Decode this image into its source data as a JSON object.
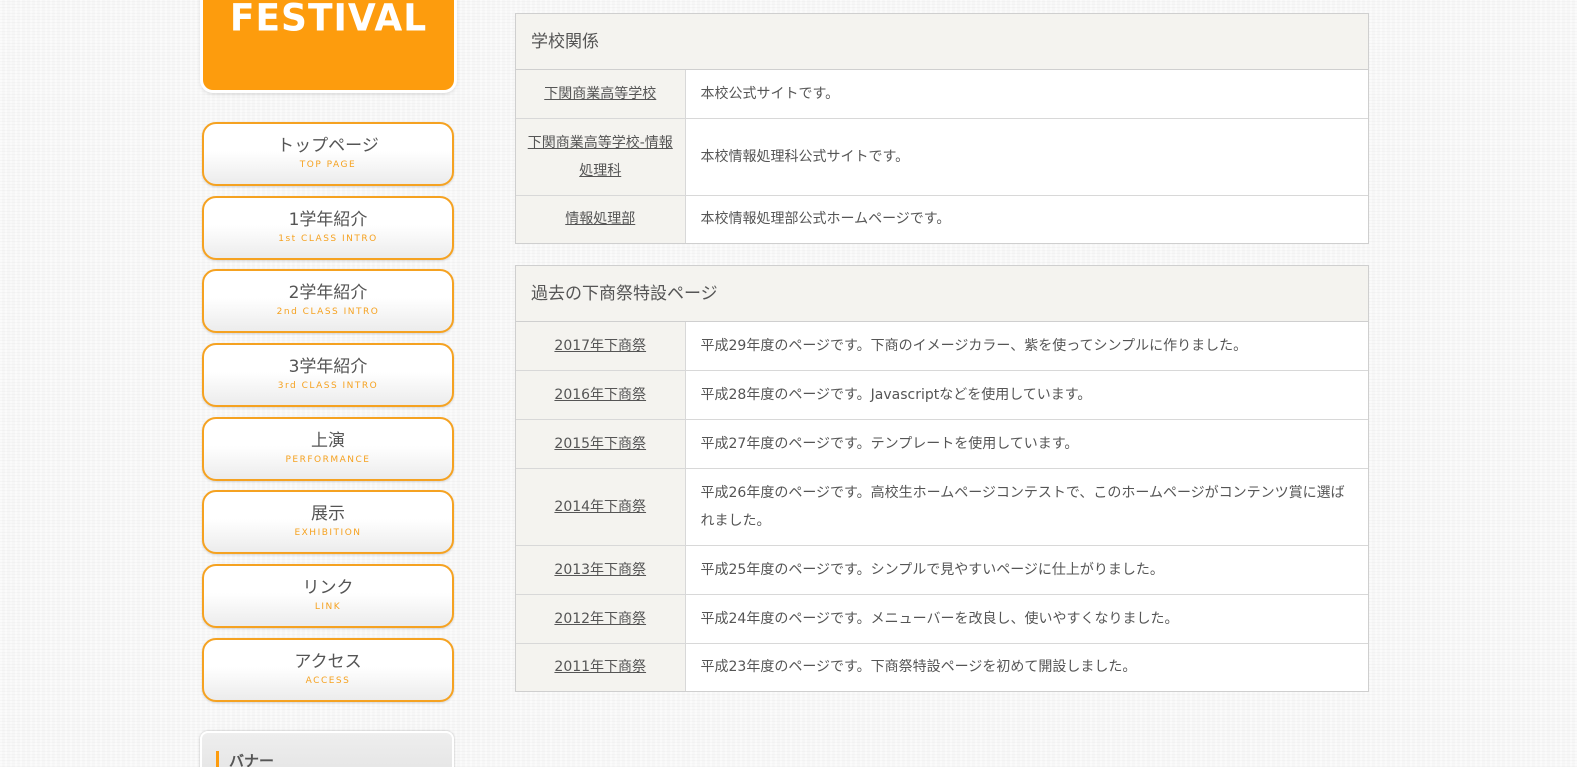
{
  "logo": {
    "text": "FESTIVAL"
  },
  "nav": [
    {
      "label": "トップページ",
      "sub": "TOP PAGE"
    },
    {
      "label": "1学年紹介",
      "sub": "1st CLASS INTRO"
    },
    {
      "label": "2学年紹介",
      "sub": "2nd CLASS INTRO"
    },
    {
      "label": "3学年紹介",
      "sub": "3rd CLASS INTRO"
    },
    {
      "label": "上演",
      "sub": "PERFORMANCE"
    },
    {
      "label": "展示",
      "sub": "EXHIBITION"
    },
    {
      "label": "リンク",
      "sub": "LINK"
    },
    {
      "label": "アクセス",
      "sub": "ACCESS"
    }
  ],
  "banner": {
    "title": "バナー"
  },
  "school_section": {
    "title": "学校関係",
    "rows": [
      {
        "name": "下関商業高等学校",
        "desc": "本校公式サイトです。"
      },
      {
        "name": "下関商業高等学校-情報処理科",
        "desc": "本校情報処理科公式サイトです。"
      },
      {
        "name": "情報処理部",
        "desc": "本校情報処理部公式ホームページです。"
      }
    ]
  },
  "past_section": {
    "title": "過去の下商祭特設ページ",
    "rows": [
      {
        "name": "2017年下商祭",
        "desc": "平成29年度のページです。下商のイメージカラー、紫を使ってシンプルに作りました。"
      },
      {
        "name": "2016年下商祭",
        "desc": "平成28年度のページです。Javascriptなどを使用しています。"
      },
      {
        "name": "2015年下商祭",
        "desc": "平成27年度のページです。テンプレートを使用しています。"
      },
      {
        "name": "2014年下商祭",
        "desc": "平成26年度のページです。高校生ホームページコンテストで、このホームページがコンテンツ賞に選ばれました。"
      },
      {
        "name": "2013年下商祭",
        "desc": "平成25年度のページです。シンプルで見やすいページに仕上がりました。"
      },
      {
        "name": "2012年下商祭",
        "desc": "平成24年度のページです。メニューバーを改良し、使いやすくなりました。"
      },
      {
        "name": "2011年下商祭",
        "desc": "平成23年度のページです。下商祭特設ページを初めて開設しました。"
      }
    ]
  },
  "colors": {
    "accent": "#fd9c0d",
    "nav_border": "#f5a221",
    "table_head_bg": "#f4f3ef",
    "text": "#555555"
  }
}
